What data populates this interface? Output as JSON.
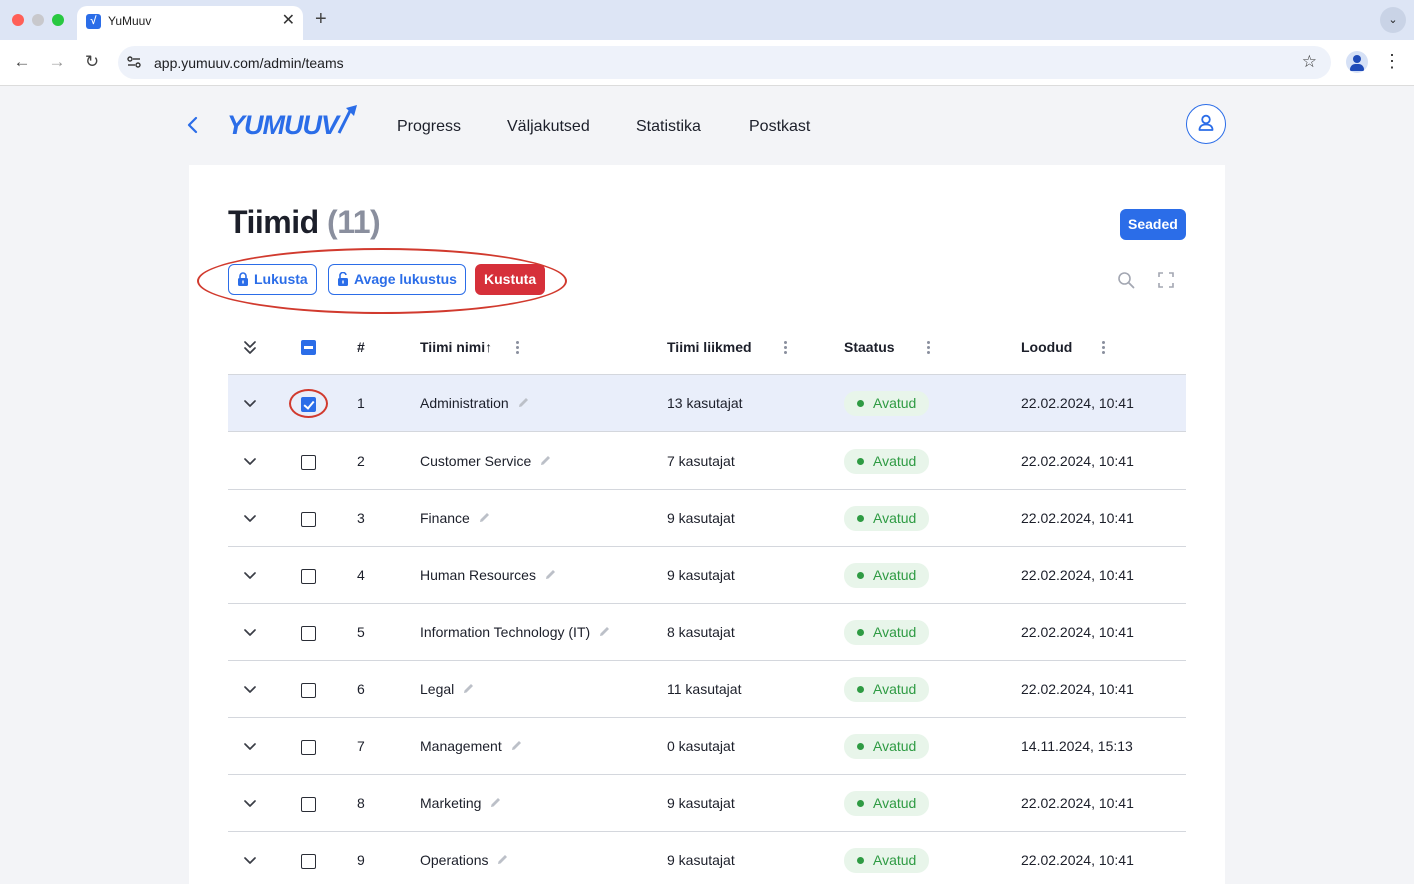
{
  "browser": {
    "tab_title": "YuMuuv",
    "favicon_letter": "√",
    "url": "app.yumuuv.com/admin/teams",
    "new_tab": "+",
    "close_tab": "✕"
  },
  "header": {
    "logo": "YUMUUV",
    "nav": [
      "Progress",
      "Väljakutsed",
      "Statistika",
      "Postkast"
    ]
  },
  "page": {
    "title": "Tiimid",
    "count": "(11)",
    "settings_label": "Seaded",
    "actions": {
      "lock": "Lukusta",
      "unlock": "Avage lukustus",
      "delete": "Kustuta"
    }
  },
  "table": {
    "columns": {
      "index": "#",
      "name": "Tiimi nimi",
      "sort_arrow": "↑",
      "members": "Tiimi liikmed",
      "status": "Staatus",
      "created": "Loodud"
    },
    "rows": [
      {
        "index": "1",
        "name": "Administration",
        "members": "13 kasutajat",
        "status": "Avatud",
        "created": "22.02.2024, 10:41",
        "checked": true
      },
      {
        "index": "2",
        "name": "Customer Service",
        "members": "7 kasutajat",
        "status": "Avatud",
        "created": "22.02.2024, 10:41",
        "checked": false
      },
      {
        "index": "3",
        "name": "Finance",
        "members": "9 kasutajat",
        "status": "Avatud",
        "created": "22.02.2024, 10:41",
        "checked": false
      },
      {
        "index": "4",
        "name": "Human Resources",
        "members": "9 kasutajat",
        "status": "Avatud",
        "created": "22.02.2024, 10:41",
        "checked": false
      },
      {
        "index": "5",
        "name": "Information Technology (IT)",
        "members": "8 kasutajat",
        "status": "Avatud",
        "created": "22.02.2024, 10:41",
        "checked": false
      },
      {
        "index": "6",
        "name": "Legal",
        "members": "11 kasutajat",
        "status": "Avatud",
        "created": "22.02.2024, 10:41",
        "checked": false
      },
      {
        "index": "7",
        "name": "Management",
        "members": "0 kasutajat",
        "status": "Avatud",
        "created": "14.11.2024, 15:13",
        "checked": false
      },
      {
        "index": "8",
        "name": "Marketing",
        "members": "9 kasutajat",
        "status": "Avatud",
        "created": "22.02.2024, 10:41",
        "checked": false
      },
      {
        "index": "9",
        "name": "Operations",
        "members": "9 kasutajat",
        "status": "Avatud",
        "created": "22.02.2024, 10:41",
        "checked": false
      }
    ]
  },
  "colors": {
    "accent": "#2b6de8",
    "danger": "#d6303a",
    "status_green": "#2e9b43",
    "selected_row": "#e9eefa",
    "annotation_red": "#d13a2e"
  }
}
